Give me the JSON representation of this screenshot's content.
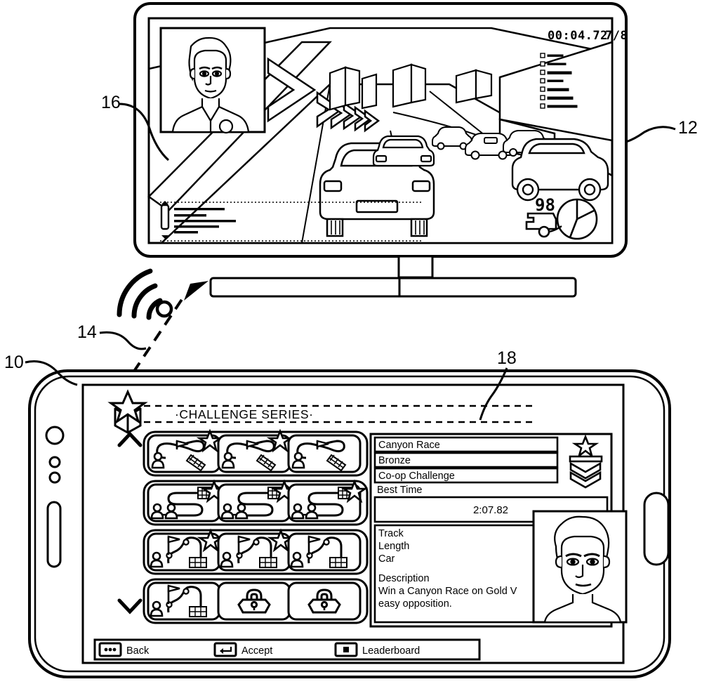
{
  "figure": {
    "type": "patent-figure",
    "reference_numerals": [
      {
        "id": "10",
        "label": "10",
        "points_to": "mobile-device"
      },
      {
        "id": "12",
        "label": "12",
        "points_to": "television-display"
      },
      {
        "id": "14",
        "label": "14",
        "points_to": "wireless-link"
      },
      {
        "id": "16",
        "label": "16",
        "points_to": "tv-driver-portrait"
      },
      {
        "id": "18",
        "label": "18",
        "points_to": "challenge-series-header"
      }
    ]
  },
  "television": {
    "name": "television-display",
    "hud": {
      "timer": "00:04.72",
      "lap_counter": "7/8",
      "speed": "98",
      "speed_unit_icon": "speedometer-icon",
      "gauge_icon": "tachometer-icon"
    },
    "picture_in_picture": {
      "name": "tv-driver-portrait",
      "caption": "driver-face-icon"
    },
    "scene": {
      "description": "racing-game-scene",
      "player_car": "player-car-icon",
      "opponent_cars": 5,
      "chevron_markers": 6,
      "buildings": 4
    },
    "message_list": {
      "name": "tv-message-ticker",
      "scrollbar": "vertical-slider-icon",
      "rows": 5
    },
    "side_panel": {
      "name": "tv-standings-panel",
      "rows": 7
    }
  },
  "mobile": {
    "name": "mobile-device",
    "hardware": {
      "camera_icon": "camera-icon",
      "sensor_icons": [
        "proximity-sensor-icon",
        "light-sensor-icon"
      ],
      "earpiece_icon": "earpiece-speaker-icon",
      "home_button_icon": "home-button-icon"
    },
    "header": {
      "badge_icon": "gift-box-star-icon",
      "title": "·CHALLENGE SERIES·"
    },
    "scroll": {
      "up_label": "scroll-up-chevron-icon",
      "down_label": "scroll-down-chevron-icon"
    },
    "grid": {
      "name": "challenge-series-grid",
      "rows": [
        {
          "row_index": 1,
          "track_style": "loop-track",
          "tiles": [
            {
              "state": "completed",
              "star": true,
              "players": 1,
              "flag": true,
              "finish": "checkered-flag-icon"
            },
            {
              "state": "completed",
              "star": true,
              "players": 1,
              "flag": true,
              "finish": "checkered-flag-icon"
            },
            {
              "state": "available",
              "star": false,
              "players": 1,
              "flag": true,
              "finish": "checkered-flag-icon"
            }
          ]
        },
        {
          "row_index": 2,
          "track_style": "s-curve-track",
          "tiles": [
            {
              "state": "completed",
              "star": true,
              "players": 2,
              "flag": false,
              "finish": "checkered-grid-icon"
            },
            {
              "state": "completed",
              "star": true,
              "players": 2,
              "flag": false,
              "finish": "checkered-grid-icon"
            },
            {
              "state": "completed",
              "star": true,
              "players": 2,
              "flag": false,
              "finish": "checkered-grid-icon"
            }
          ]
        },
        {
          "row_index": 3,
          "track_style": "hairpin-track",
          "tiles": [
            {
              "state": "completed",
              "star": true,
              "players": 1,
              "flag": true,
              "finish": "checkered-grid-icon"
            },
            {
              "state": "completed",
              "star": true,
              "players": 1,
              "flag": true,
              "finish": "checkered-grid-icon"
            },
            {
              "state": "available",
              "star": false,
              "players": 1,
              "flag": true,
              "finish": "checkered-grid-icon"
            }
          ]
        },
        {
          "row_index": 4,
          "track_style": "hairpin-track",
          "tiles": [
            {
              "state": "available",
              "star": false,
              "players": 1,
              "flag": true,
              "finish": "checkered-grid-icon"
            },
            {
              "state": "locked",
              "star": false,
              "lock": "padlock-icon"
            },
            {
              "state": "locked",
              "star": false,
              "lock": "padlock-icon"
            }
          ]
        }
      ]
    },
    "detail_panel": {
      "name": "challenge-detail-panel",
      "race_name": "Canyon Race",
      "medal": "Bronze",
      "mode": "Co-op Challenge",
      "best_time_label": "Best  Time",
      "best_time_value": "2:07.82",
      "stats": [
        {
          "label": "Track",
          "value": ""
        },
        {
          "label": "Length",
          "value": ""
        },
        {
          "label": "Car",
          "value": ""
        }
      ],
      "description_label": "Description",
      "description_lines": [
        "Win a Canyon Race on Gold V",
        "easy opposition."
      ],
      "rank_badge_icon": "rank-chevron-star-icon",
      "avatar_icon": "player-avatar-icon"
    },
    "bottom_bar": {
      "name": "action-bar",
      "actions": [
        {
          "icon": "three-dots-button-icon",
          "label": "Back"
        },
        {
          "icon": "enter-key-icon",
          "label": "Accept"
        },
        {
          "icon": "square-button-icon",
          "label": "Leaderboard"
        }
      ]
    }
  },
  "colors": {
    "ink": "#000000",
    "paper": "#ffffff"
  }
}
